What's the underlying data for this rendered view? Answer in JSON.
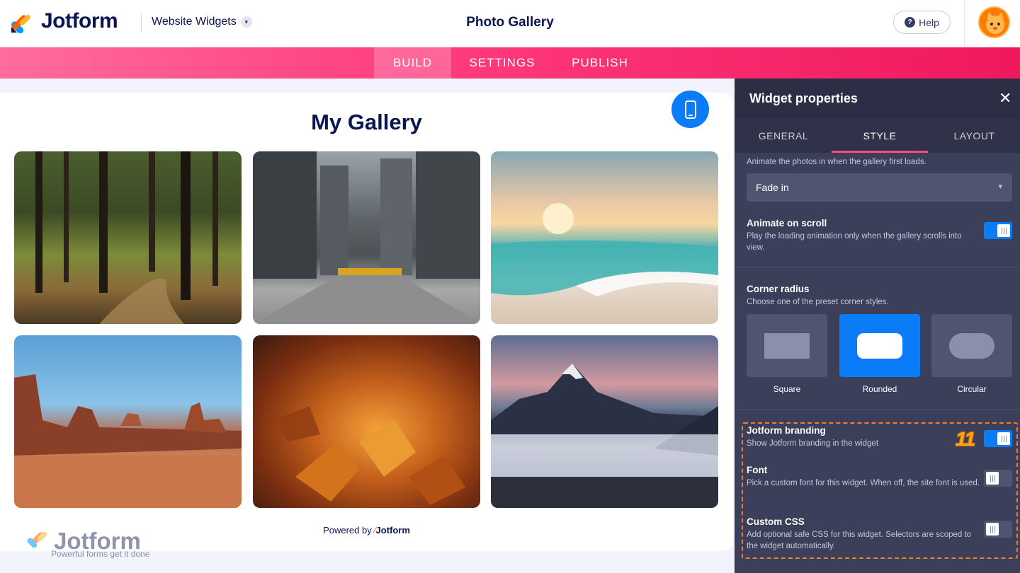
{
  "header": {
    "brand": "Jotform",
    "product": "Website Widgets",
    "title": "Photo Gallery",
    "help_label": "Help"
  },
  "tabs": [
    {
      "label": "BUILD",
      "active": true
    },
    {
      "label": "SETTINGS",
      "active": false
    },
    {
      "label": "PUBLISH",
      "active": false
    }
  ],
  "preview": {
    "gallery_title": "My Gallery",
    "photos": [
      {
        "subject": "forest path"
      },
      {
        "subject": "city street"
      },
      {
        "subject": "beach sunset"
      },
      {
        "subject": "desert buttes"
      },
      {
        "subject": "autumn leaves"
      },
      {
        "subject": "mountains above clouds"
      }
    ],
    "powered_prefix": "Powered by",
    "powered_brand": "Jotform",
    "watermark_name": "Jotform",
    "watermark_tagline": "Powerful forms get it done"
  },
  "panel": {
    "title": "Widget properties",
    "tabs": [
      {
        "label": "GENERAL",
        "active": false
      },
      {
        "label": "STYLE",
        "active": true
      },
      {
        "label": "LAYOUT",
        "active": false
      }
    ],
    "loading": {
      "desc": "Animate the photos in when the gallery first loads.",
      "value": "Fade in"
    },
    "animate_scroll": {
      "label": "Animate on scroll",
      "desc": "Play the loading animation only when the gallery scrolls into view.",
      "on": true
    },
    "corner": {
      "label": "Corner radius",
      "desc": "Choose one of the preset corner styles.",
      "options": [
        "Square",
        "Rounded",
        "Circular"
      ],
      "selected": "Rounded"
    },
    "branding": {
      "label": "Jotform branding",
      "desc": "Show Jotform branding in the widget",
      "on": true
    },
    "font": {
      "label": "Font",
      "desc": "Pick a custom font for this widget. When off, the site font is used.",
      "on": false
    },
    "css": {
      "label": "Custom CSS",
      "desc": "Add optional safe CSS for this widget. Selectors are scoped to the widget automatically.",
      "on": false
    },
    "step_marker": "11"
  },
  "colors": {
    "accent_pink": "#ff3d7f",
    "accent_blue": "#0a7cf7",
    "panel_bg": "#3b3f59",
    "highlight_orange": "#f07d2c"
  }
}
